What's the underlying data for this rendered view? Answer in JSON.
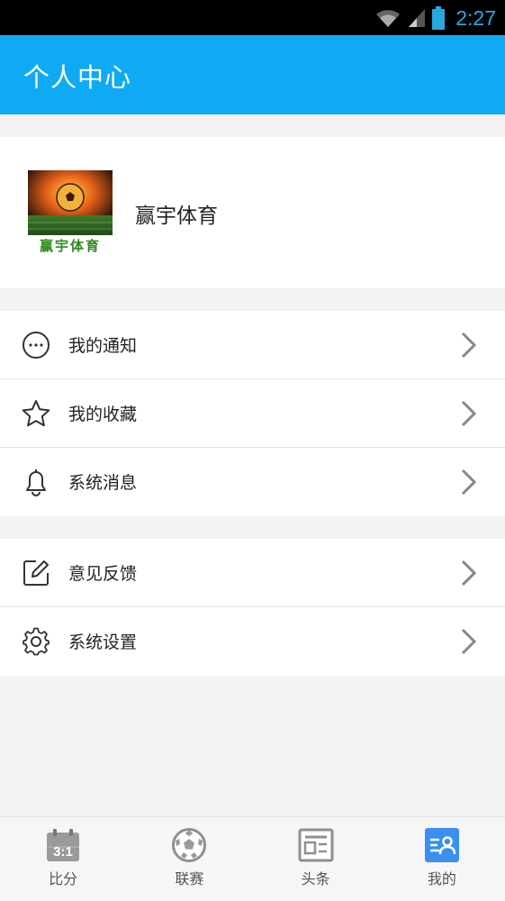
{
  "status_bar": {
    "time": "2:27"
  },
  "header": {
    "title": "个人中心"
  },
  "profile": {
    "name": "赢宇体育",
    "logo_caption": "赢宇体育"
  },
  "menu_group_1": [
    {
      "label": "我的通知",
      "icon": "more-circle-icon"
    },
    {
      "label": "我的收藏",
      "icon": "star-icon"
    },
    {
      "label": "系统消息",
      "icon": "bell-icon"
    }
  ],
  "menu_group_2": [
    {
      "label": "意见反馈",
      "icon": "edit-icon"
    },
    {
      "label": "系统设置",
      "icon": "gear-icon"
    }
  ],
  "bottom_nav": [
    {
      "label": "比分",
      "icon": "scoreboard-icon",
      "icon_text": "3:1"
    },
    {
      "label": "联赛",
      "icon": "soccer-ball-icon"
    },
    {
      "label": "头条",
      "icon": "news-icon"
    },
    {
      "label": "我的",
      "icon": "profile-icon",
      "active": true
    }
  ],
  "colors": {
    "accent": "#10aaf4",
    "status_time": "#29a8e0",
    "background": "#f3f3f3"
  }
}
